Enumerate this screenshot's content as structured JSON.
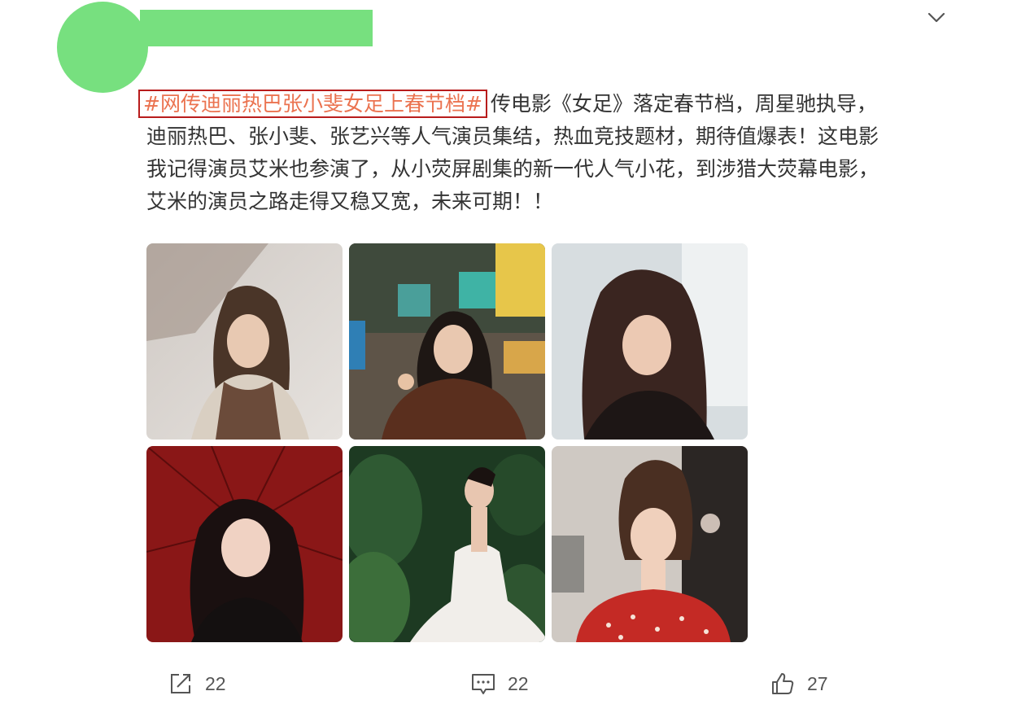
{
  "post": {
    "topic": "#网传迪丽热巴张小斐女足上春节档#",
    "lines": [
      "传电影《女足》落定春节档，周星驰执导，",
      "迪丽热巴、张小斐、张艺兴等人气演员集结，热血竞技题材，期待值爆表！这电影",
      "我记得演员艾米也参演了，从小荧屏剧集的新一代人气小花，到涉猎大荧幕电影，",
      "艾米的演员之路走得又稳又宽，未来可期！！"
    ]
  },
  "icons": {
    "more": "chevron-down-icon",
    "share": "share-icon",
    "comment": "comment-icon",
    "like": "thumbs-up-icon"
  },
  "actions": {
    "share_count": "22",
    "comment_count": "22",
    "like_count": "27"
  },
  "colors": {
    "avatar_redaction": "#77e07f",
    "topic_text": "#eb7350",
    "topic_border": "#b81c1c"
  }
}
